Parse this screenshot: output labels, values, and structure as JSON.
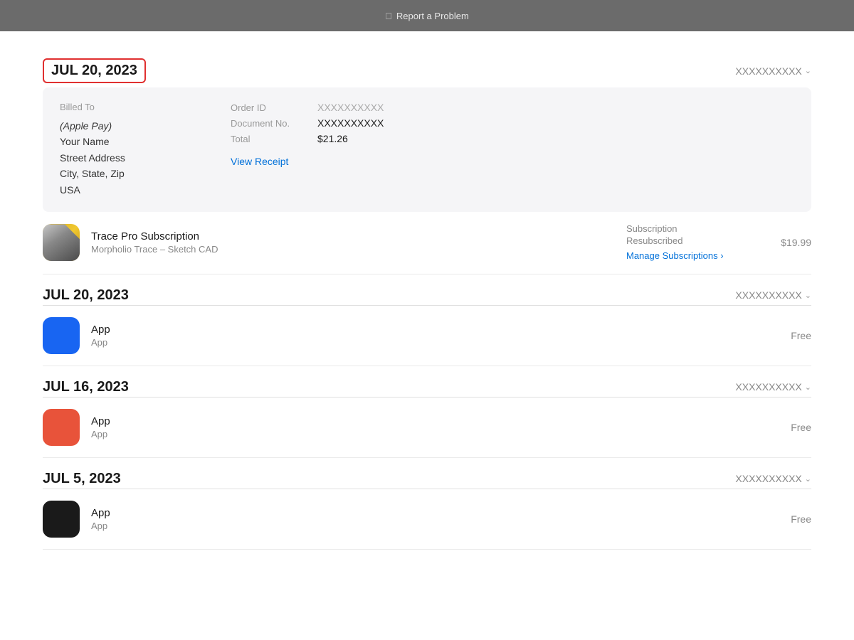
{
  "titleBar": {
    "appleSymbol": "",
    "text": "Report a Problem"
  },
  "sections": [
    {
      "id": "section-1",
      "date": "JUL 20, 2023",
      "highlighted": true,
      "orderId": "XXXXXXXXXX",
      "hasDetail": true,
      "detail": {
        "billedTo": {
          "label": "Billed To",
          "paymentMethod": "(Apple Pay)",
          "name": "Your Name",
          "street": "Street Address",
          "cityStateZip": "City, State, Zip",
          "country": "USA"
        },
        "orderId": {
          "label": "Order ID",
          "value": "XXXXXXXXXX"
        },
        "documentNo": {
          "label": "Document No.",
          "value": "XXXXXXXXXX"
        },
        "total": {
          "label": "Total",
          "value": "$21.26"
        },
        "viewReceiptLabel": "View Receipt"
      },
      "apps": [
        {
          "iconStyle": "trace-pro",
          "name": "Trace Pro Subscription",
          "subtitle": "Morpholio Trace – Sketch CAD",
          "subType": "Subscription",
          "subStatus": "Resubscribed",
          "manageLabel": "Manage Subscriptions ›",
          "price": "$19.99"
        }
      ]
    },
    {
      "id": "section-2",
      "date": "JUL 20, 2023",
      "highlighted": false,
      "orderId": "XXXXXXXXXX",
      "hasDetail": false,
      "apps": [
        {
          "iconStyle": "blue-app",
          "name": "App",
          "subtitle": "App",
          "subType": null,
          "subStatus": null,
          "manageLabel": null,
          "price": "Free"
        }
      ]
    },
    {
      "id": "section-3",
      "date": "JUL 16, 2023",
      "highlighted": false,
      "orderId": "XXXXXXXXXX",
      "hasDetail": false,
      "apps": [
        {
          "iconStyle": "red-app",
          "name": "App",
          "subtitle": "App",
          "subType": null,
          "subStatus": null,
          "manageLabel": null,
          "price": "Free"
        }
      ]
    },
    {
      "id": "section-4",
      "date": "JUL 5, 2023",
      "highlighted": false,
      "orderId": "XXXXXXXXXX",
      "hasDetail": false,
      "apps": [
        {
          "iconStyle": "black-app",
          "name": "App",
          "subtitle": "App",
          "subType": null,
          "subStatus": null,
          "manageLabel": null,
          "price": "Free"
        }
      ]
    }
  ]
}
